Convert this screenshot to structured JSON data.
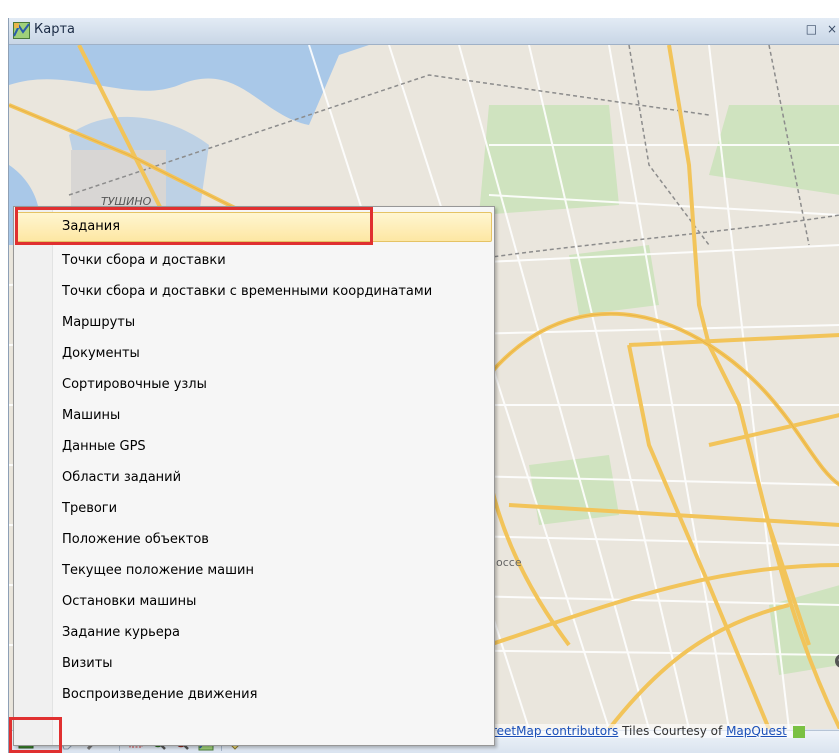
{
  "window": {
    "title": "Карта",
    "controls": [
      "□",
      "×"
    ]
  },
  "map": {
    "place_label": "ТУШИНО",
    "road_label": "оссе",
    "zoom_in_symbol": "+",
    "attribution": {
      "prefix": "",
      "link1": "reetMap contributors",
      "middle": " Tiles Courtesy of ",
      "link2": "MapQuest"
    }
  },
  "menu": {
    "items": [
      {
        "label": "Задания",
        "highlighted": true
      },
      {
        "label": "Точки сбора и доставки"
      },
      {
        "label": "Точки сбора и доставки с временными координатами"
      },
      {
        "label": "Маршруты"
      },
      {
        "label": "Документы"
      },
      {
        "label": "Сортировочные узлы"
      },
      {
        "label": "Машины"
      },
      {
        "label": "Данные GPS"
      },
      {
        "label": "Области заданий"
      },
      {
        "label": "Тревоги"
      },
      {
        "label": "Положение объектов"
      },
      {
        "label": "Текущее положение машин"
      },
      {
        "label": "Остановки машины"
      },
      {
        "label": "Задание курьера"
      },
      {
        "label": "Визиты"
      },
      {
        "label": "Воспроизведение движения"
      }
    ]
  },
  "toolbar": {
    "buttons": [
      "layers-dropdown-icon",
      "eraser-icon",
      "tools-dropdown-icon",
      "select-rect-icon",
      "zoom-in-icon",
      "zoom-out-icon",
      "map-icon",
      "ruler-icon"
    ]
  },
  "colors": {
    "highlight_border": "#e03030",
    "menu_highlight": "#fde7a3",
    "road_major": "#f2c45a"
  }
}
